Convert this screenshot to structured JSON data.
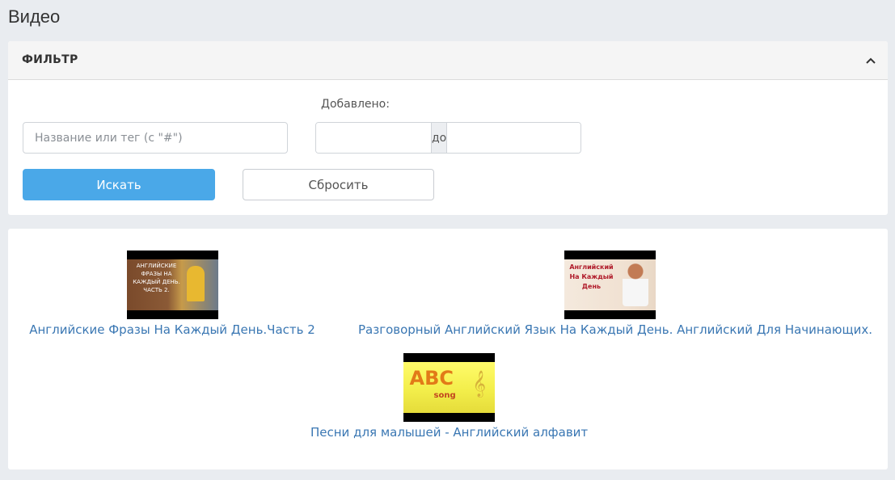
{
  "page": {
    "title": "Видео"
  },
  "filter": {
    "title": "ФИЛЬТР",
    "search_placeholder": "Название или тег (с \"#\")",
    "search_value": "",
    "added_label": "Добавлено:",
    "date_from_value": "",
    "date_separator": "до",
    "date_to_value": "",
    "search_button": "Искать",
    "reset_button": "Сбросить",
    "collapse_icon": "chevron-up-icon"
  },
  "videos": [
    {
      "title": "Английские Фразы На Каждый День.Часть 2",
      "thumb_text": "АНГЛИЙСКИЕ ФРАЗЫ НА КАЖДЫЙ ДЕНЬ. ЧАСТЬ 2."
    },
    {
      "title": "Разговорный Английский Язык На Каждый День. Английский Для Начинающих.",
      "thumb_text": "Английский На Каждый День"
    },
    {
      "title": "Песни для малышей - Английский алфавит",
      "thumb_text": "ABC",
      "thumb_subtext": "song"
    }
  ],
  "colors": {
    "link": "#3a77b3",
    "primary_button": "#4aa8e8",
    "background": "#e9ecf0"
  }
}
